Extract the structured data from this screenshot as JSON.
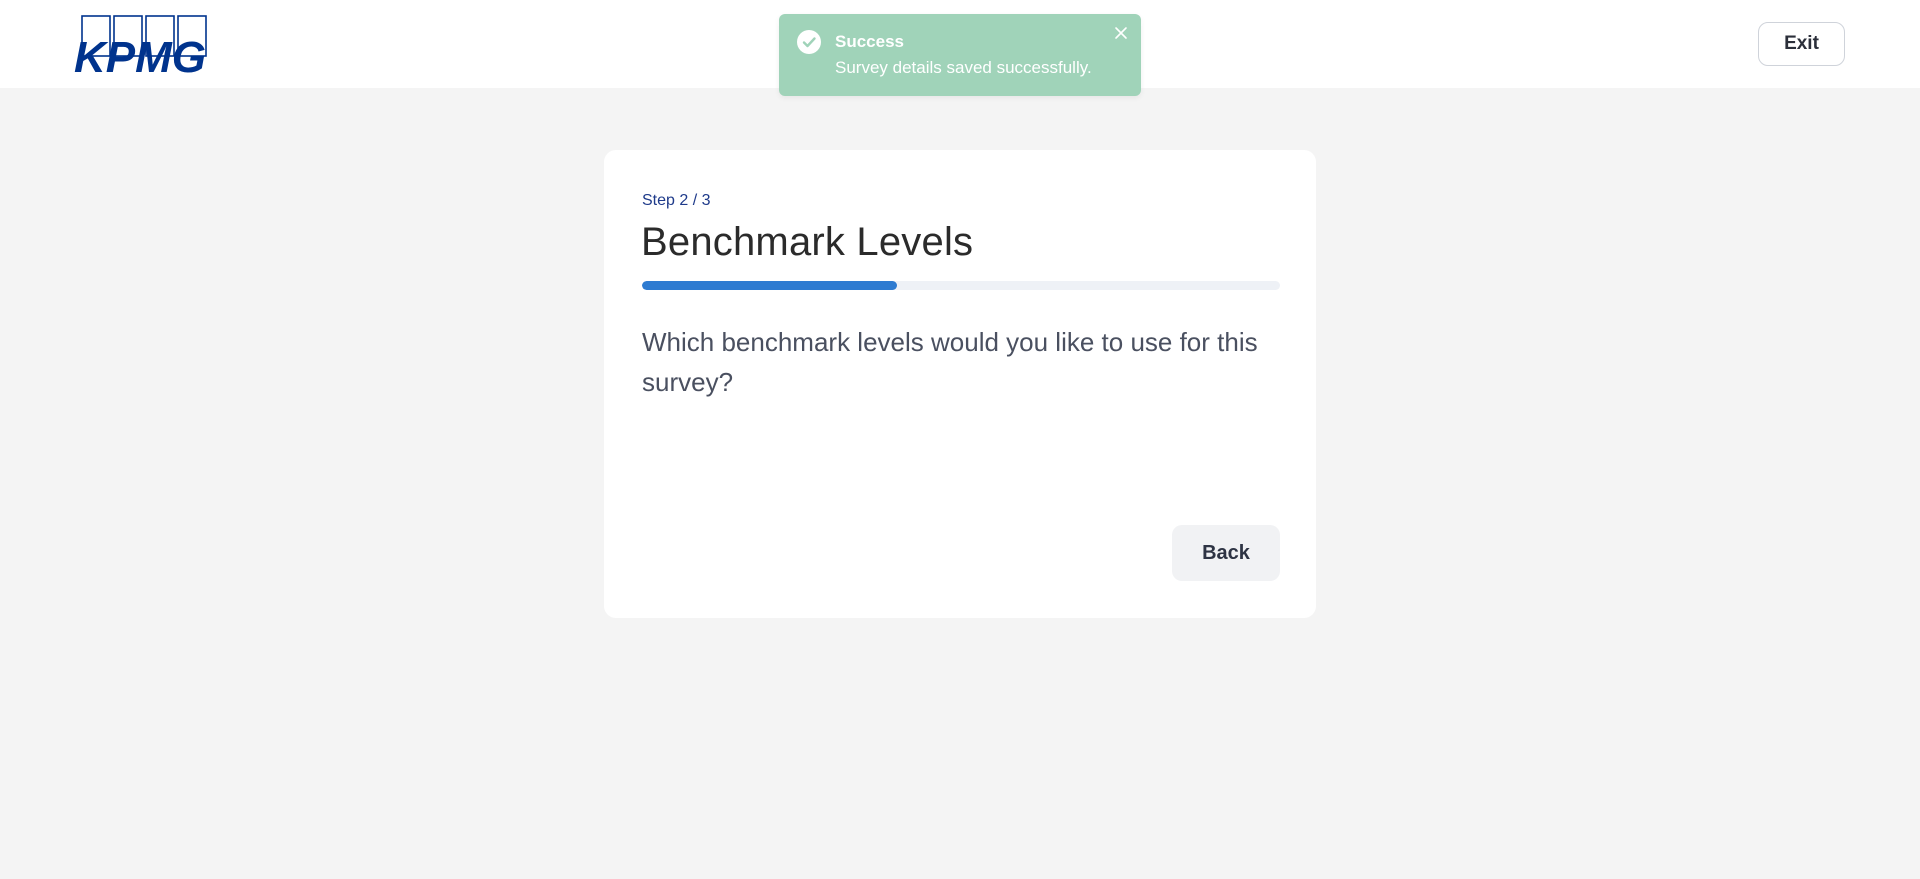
{
  "header": {
    "logo_text": "KPMG",
    "exit_label": "Exit"
  },
  "toast": {
    "icon": "check-circle-icon",
    "title": "Success",
    "message": "Survey details saved successfully.",
    "close_icon": "close-icon",
    "background_color": "#a0d3b9"
  },
  "card": {
    "step_label": "Step 2 / 3",
    "title": "Benchmark Levels",
    "progress_fraction": 0.4,
    "question": "Which benchmark levels would you like to use for this survey?",
    "back_label": "Back"
  },
  "colors": {
    "brand_blue": "#00338d",
    "progress_blue": "#2e7bd1",
    "page_background": "#f4f4f4"
  }
}
